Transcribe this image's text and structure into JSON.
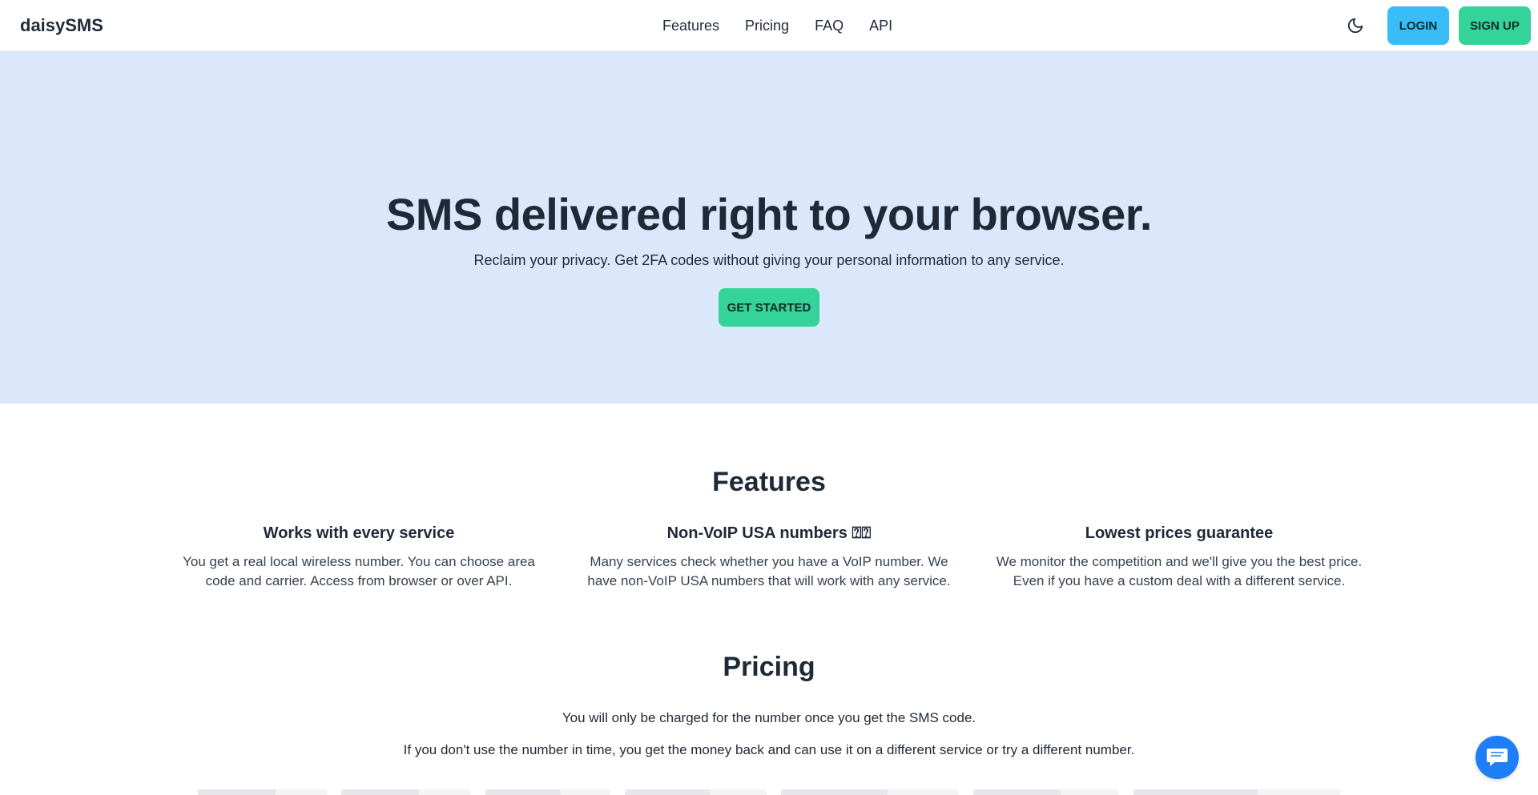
{
  "navbar": {
    "logo": "daisySMS",
    "links": [
      "Features",
      "Pricing",
      "FAQ",
      "API"
    ],
    "theme_icon": "moon-icon",
    "login_label": "LOGIN",
    "signup_label": "SIGN UP"
  },
  "hero": {
    "title": "SMS delivered right to your browser.",
    "subtitle": "Reclaim your privacy. Get 2FA codes without giving your personal information to any service.",
    "cta_label": "GET STARTED"
  },
  "features": {
    "title": "Features",
    "items": [
      {
        "title": "Works with every service",
        "text": "You get a real local wireless number. You can choose area code and carrier. Access from browser or over API."
      },
      {
        "title": "Non-VoIP USA numbers ⍰⍰",
        "text": "Many services check whether you have a VoIP number. We have non-VoIP USA numbers that will work with any service."
      },
      {
        "title": "Lowest prices guarantee",
        "text": "We monitor the competition and we'll give you the best price. Even if you have a custom deal with a different service."
      }
    ]
  },
  "pricing": {
    "title": "Pricing",
    "line1": "You will only be charged for the number once you get the SMS code.",
    "line2": "If you don't use the number in time, you get the money back and can use it on a different service or try a different number."
  },
  "chat": {
    "icon": "chat-bubble-icon"
  },
  "colors": {
    "hero_bg": "#dbe8fc",
    "login": "#38bdf8",
    "signup": "#34d399",
    "chat": "#1d7ef5"
  }
}
